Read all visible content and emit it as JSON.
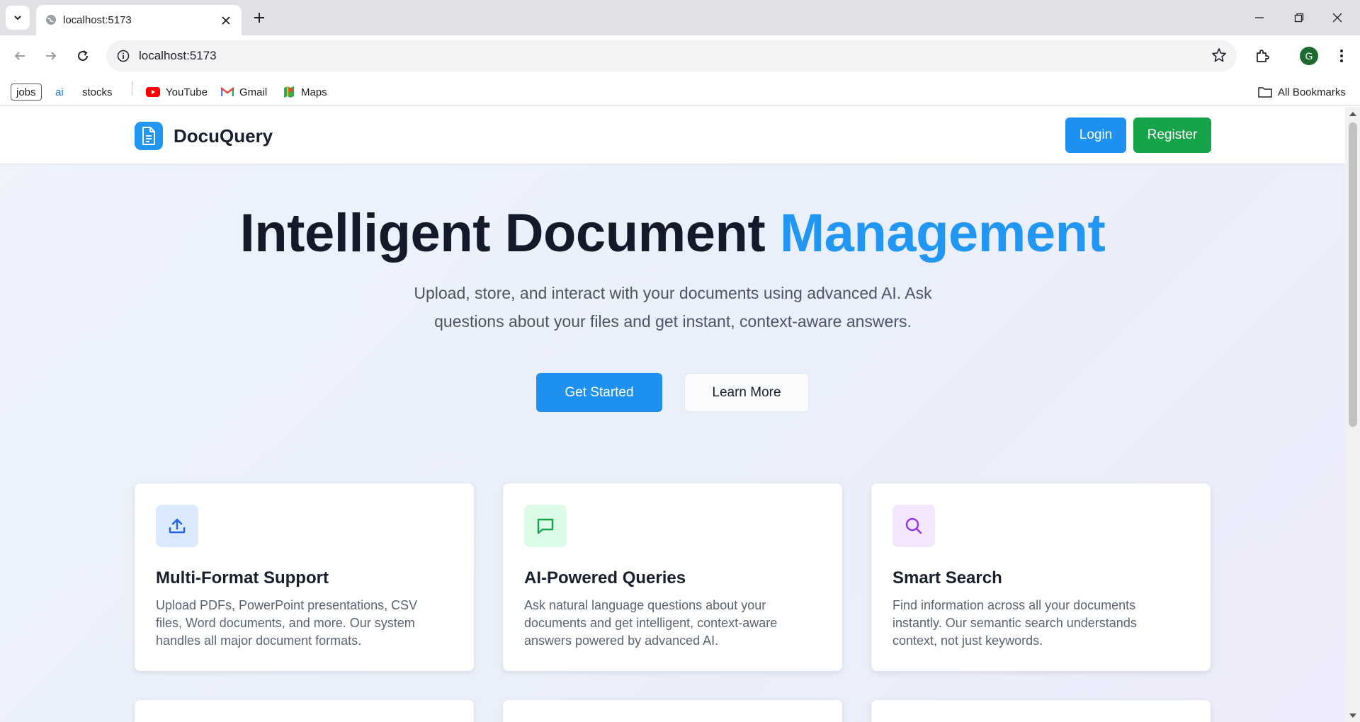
{
  "browser": {
    "tab_title": "localhost:5173",
    "url": "localhost:5173",
    "profile_initial": "G",
    "bookmarks": [
      "jobs",
      "ai",
      "stocks",
      "YouTube",
      "Gmail",
      "Maps"
    ],
    "all_bookmarks_label": "All Bookmarks"
  },
  "site": {
    "brand": "DocuQuery",
    "login_label": "Login",
    "register_label": "Register",
    "hero_title_main": "Intelligent Document",
    "hero_title_accent": "Management",
    "hero_subtitle": "Upload, store, and interact with your documents using advanced AI. Ask questions about your files and get instant, context-aware answers.",
    "get_started_label": "Get Started",
    "learn_more_label": "Learn More",
    "features": [
      {
        "title": "Multi-Format Support",
        "description": "Upload PDFs, PowerPoint presentations, CSV files, Word documents, and more. Our system handles all major document formats.",
        "icon": "upload-icon",
        "icon_bg": "#dbeafe",
        "icon_color": "#2563eb"
      },
      {
        "title": "AI-Powered Queries",
        "description": "Ask natural language questions about your documents and get intelligent, context-aware answers powered by advanced AI.",
        "icon": "chat-icon",
        "icon_bg": "#dcfce7",
        "icon_color": "#16a34a"
      },
      {
        "title": "Smart Search",
        "description": "Find information across all your documents instantly. Our semantic search understands context, not just keywords.",
        "icon": "search-icon",
        "icon_bg": "#f3e8ff",
        "icon_color": "#9333ea"
      }
    ]
  },
  "colors": {
    "primary": "#1e90f0",
    "success": "#17a34a",
    "accent_text": "#2196f3"
  }
}
